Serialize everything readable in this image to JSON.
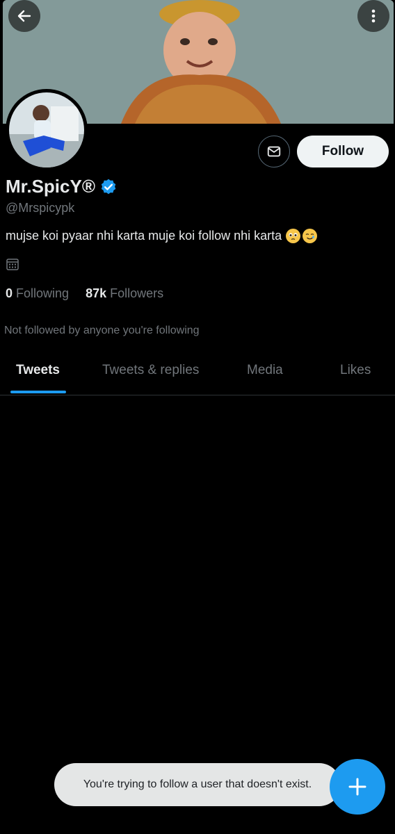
{
  "profile": {
    "display_name": "Mr.SpicY®",
    "handle": "@Mrspicypk",
    "bio": "mujse koi pyaar nhi karta muje koi follow nhi karta",
    "following_count": "0",
    "following_label": "Following",
    "followers_count": "87k",
    "followers_label": "Followers",
    "not_followed_text": "Not followed by anyone you're following"
  },
  "header": {
    "back_icon": "arrow-left-icon",
    "more_icon": "more-vertical-icon"
  },
  "actions": {
    "message_icon": "envelope-icon",
    "follow_label": "Follow"
  },
  "tabs": [
    {
      "label": "Tweets"
    },
    {
      "label": "Tweets & replies"
    },
    {
      "label": "Media"
    },
    {
      "label": "Likes"
    }
  ],
  "toast": {
    "text": "You're trying to follow a user that doesn't exist."
  },
  "fab": {
    "icon": "plus-icon"
  },
  "colors": {
    "accent": "#1d9bf0",
    "background": "#000000",
    "secondary_text": "#71767b"
  }
}
